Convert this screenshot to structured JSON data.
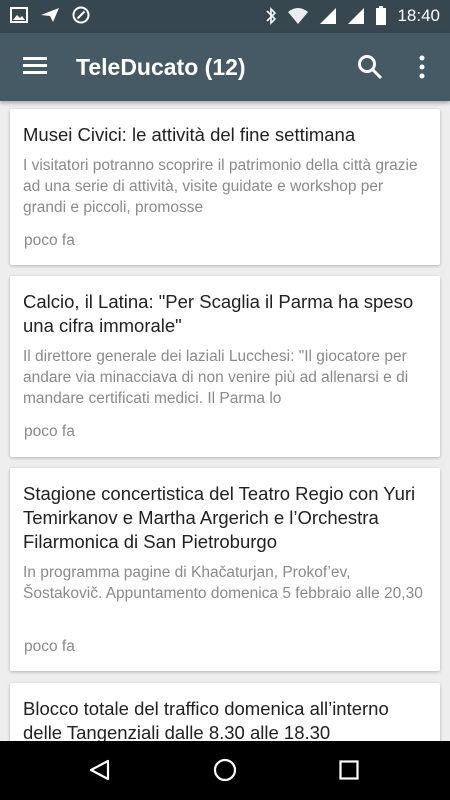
{
  "status": {
    "time": "18:40"
  },
  "appbar": {
    "title": "TeleDucato (12)"
  },
  "articles": [
    {
      "title": "Musei Civici: le attività del fine settimana",
      "summary": "I visitatori potranno scoprire il patrimonio della città grazie ad una serie di attività, visite guidate e workshop per grandi e piccoli, promosse",
      "time": "poco fa"
    },
    {
      "title": "Calcio, il Latina: \"Per Scaglia il Parma ha speso una cifra immorale\"",
      "summary": "Il direttore generale dei laziali Lucchesi: \"Il giocatore per andare via minacciava di non venire più ad allenarsi e di mandare certificati medici. Il Parma lo",
      "time": "poco fa"
    },
    {
      "title": "Stagione concertistica del Teatro Regio con Yuri Temirkanov e Martha Argerich e l’Orchestra Filarmonica di San Pietroburgo",
      "summary": "In programma pagine di Khačaturjan, Prokof’ev, Šostakovič. Appuntamento domenica 5 febbraio alle 20,30",
      "time": "poco fa"
    },
    {
      "title": "Blocco totale del traffico domenica all’interno delle Tangenziali dalle 8.30 alle 18.30"
    }
  ]
}
